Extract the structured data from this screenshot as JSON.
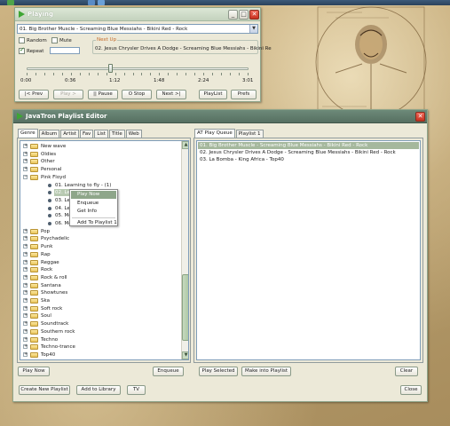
{
  "desktop": {
    "accent_color": "#3ea633"
  },
  "taskbar": {
    "icons": [
      "app-icon-green",
      "app-icon-blue",
      "music-note-icon"
    ]
  },
  "playing": {
    "title": "Playing",
    "current_track": "01. Big Brother Muscle - Screaming Blue Messiahs - Bikini Red - Rock",
    "random_label": "Random",
    "mute_label": "Mute",
    "repeat_label": "Repeat",
    "random_checked": false,
    "mute_checked": false,
    "repeat_checked": true,
    "next_up_label": "Next Up",
    "next_up_track": "02. Jesus Chrysler Drives A Dodge - Screaming Blue Messiahs - Bikini Re",
    "position_fraction": 0.38,
    "times": [
      "0:00",
      "0:36",
      "1:12",
      "1:48",
      "2:24",
      "3:01"
    ],
    "buttons": {
      "prev": "|< Prev",
      "play": "Play >",
      "pause": "|| Pause",
      "stop": "O Stop",
      "next": "Next >|",
      "playlist": "PlayList",
      "prefs": "Prefs"
    }
  },
  "editor": {
    "title": "JavaTron Playlist Editor",
    "library_tabs": [
      "Genre",
      "Album",
      "Artist",
      "Fav",
      "List",
      "Title",
      "Web"
    ],
    "active_library_tab": "Genre",
    "tree": [
      {
        "label": "New wave",
        "type": "folder",
        "expanded": false
      },
      {
        "label": "Oldies",
        "type": "folder",
        "expanded": false
      },
      {
        "label": "Other",
        "type": "folder",
        "expanded": false
      },
      {
        "label": "Personal",
        "type": "folder",
        "expanded": false
      },
      {
        "label": "Pink Floyd",
        "type": "folder",
        "expanded": true
      },
      {
        "label": "01. Learning to fly - (1)",
        "type": "track"
      },
      {
        "label": "02. Learni",
        "type": "track",
        "selected": true
      },
      {
        "label": "03. Learni",
        "type": "track"
      },
      {
        "label": "04. Learni",
        "type": "track"
      },
      {
        "label": "05. Money",
        "type": "track"
      },
      {
        "label": "06. Money",
        "type": "track"
      },
      {
        "label": "Pop",
        "type": "folder",
        "expanded": false
      },
      {
        "label": "Psychadelic",
        "type": "folder",
        "expanded": false
      },
      {
        "label": "Punk",
        "type": "folder",
        "expanded": false
      },
      {
        "label": "Rap",
        "type": "folder",
        "expanded": false
      },
      {
        "label": "Reggae",
        "type": "folder",
        "expanded": false
      },
      {
        "label": "Rock",
        "type": "folder",
        "expanded": false
      },
      {
        "label": "Rock & roll",
        "type": "folder",
        "expanded": false
      },
      {
        "label": "Santana",
        "type": "folder",
        "expanded": false
      },
      {
        "label": "Showtunes",
        "type": "folder",
        "expanded": false
      },
      {
        "label": "Ska",
        "type": "folder",
        "expanded": false
      },
      {
        "label": "Soft rock",
        "type": "folder",
        "expanded": false
      },
      {
        "label": "Soul",
        "type": "folder",
        "expanded": false
      },
      {
        "label": "Soundtrack",
        "type": "folder",
        "expanded": false
      },
      {
        "label": "Southern rock",
        "type": "folder",
        "expanded": false
      },
      {
        "label": "Techno",
        "type": "folder",
        "expanded": false
      },
      {
        "label": "Techno-trance",
        "type": "folder",
        "expanded": false
      },
      {
        "label": "Top40",
        "type": "folder",
        "expanded": false
      }
    ],
    "context_menu": [
      "Play Now",
      "Enqueue",
      "Get Info",
      "Add To Playlist 1"
    ],
    "context_menu_highlighted": "Play Now",
    "left_buttons": {
      "play_now": "Play Now",
      "enqueue": "Enqueue"
    },
    "queue_tabs": [
      "AT Play Queue",
      "Playlist 1"
    ],
    "active_queue_tab": "AT Play Queue",
    "queue": [
      "01. Big Brother Muscle - Screaming Blue Messiahs - Bikini Red - Rock",
      "02. Jesus Chrysler Drives A Dodge - Screaming Blue Messiahs - Bikini Red - Rock",
      "03. La Bomba - King Africa - Top40"
    ],
    "queue_selected_index": 0,
    "queue_buttons": {
      "play_selected": "Play Selected",
      "make_into_playlist": "Make into Playlist",
      "clear": "Clear"
    },
    "bottom_buttons": {
      "create_new_playlist": "Create New Playlist",
      "add_to_library": "Add to Library",
      "tv": "TV",
      "close": "Close"
    }
  }
}
